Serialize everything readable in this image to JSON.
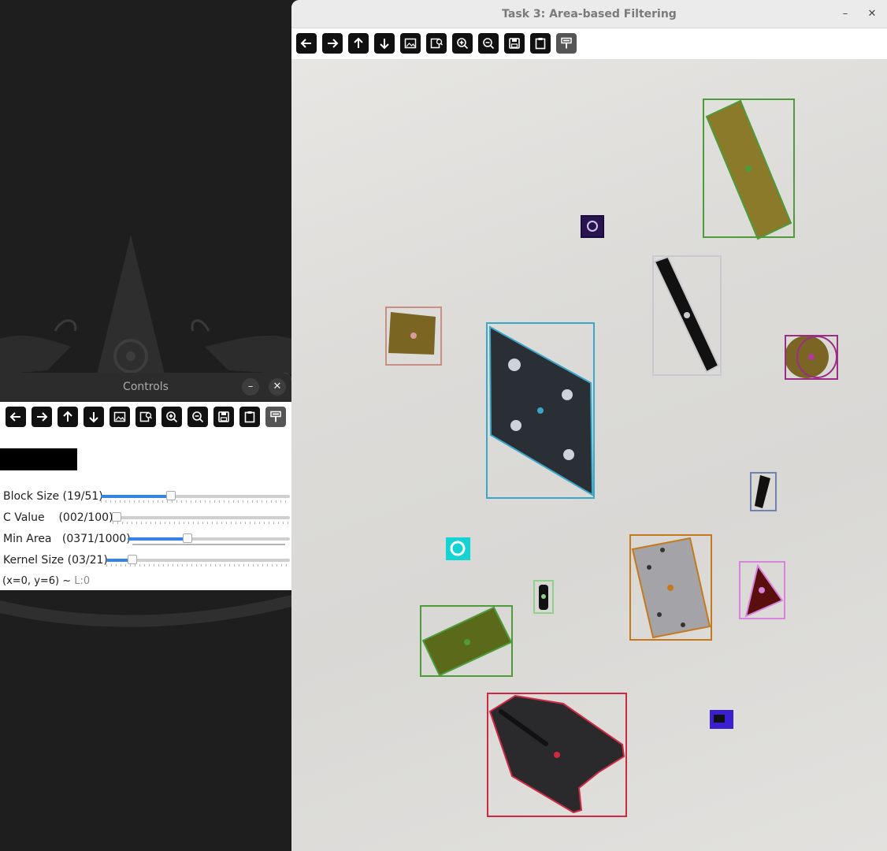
{
  "main_window": {
    "title": "Task 3: Area-based Filtering",
    "minimize_glyph": "–",
    "close_glyph": "✕",
    "toolbar_icons": [
      "arrow-left-icon",
      "arrow-right-icon",
      "arrow-up-icon",
      "arrow-down-icon",
      "image-icon",
      "image-zoom-icon",
      "zoom-in-icon",
      "zoom-out-icon",
      "save-icon",
      "clipboard-icon",
      "properties-icon"
    ]
  },
  "controls_window": {
    "title": "Controls",
    "minimize_glyph": "–",
    "close_glyph": "✕",
    "sliders": [
      {
        "label": "Block Size (19/51)",
        "value": 19,
        "max": 51
      },
      {
        "label": "C Value    (002/100)",
        "value": 2,
        "max": 100
      },
      {
        "label": "Min Area   (0371/1000)",
        "value": 371,
        "max": 1000
      },
      {
        "label": "Kernel Size (03/21)",
        "value": 3,
        "max": 21
      }
    ],
    "status": {
      "coords": "(x=0, y=6) ~ ",
      "level": "L:0"
    }
  },
  "detections": [
    {
      "name": "wood-block-large",
      "color": "#4f9a3a"
    },
    {
      "name": "small-dark-nut",
      "color": "#2a1450"
    },
    {
      "name": "black-bar",
      "color": "#c9c9cf"
    },
    {
      "name": "small-wood-cube",
      "color": "#c98f84"
    },
    {
      "name": "metal-plate-parallelogram",
      "color": "#3aa6c8"
    },
    {
      "name": "wood-cylinder",
      "color": "#9a2d84"
    },
    {
      "name": "small-bolt",
      "color": "#6e84b0"
    },
    {
      "name": "cyan-washer",
      "color": "#15d3d3"
    },
    {
      "name": "green-small-part",
      "color": "#8fd08a"
    },
    {
      "name": "aluminum-plate",
      "color": "#c47a1c"
    },
    {
      "name": "red-triangle-piece",
      "color": "#d884dc"
    },
    {
      "name": "green-wood-block",
      "color": "#4f9a3a"
    },
    {
      "name": "black-large-plate",
      "color": "#cc2a44"
    },
    {
      "name": "blue-small-part",
      "color": "#3a20d0"
    }
  ]
}
